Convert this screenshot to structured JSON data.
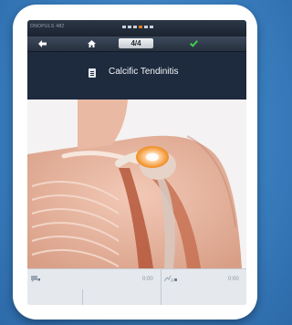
{
  "status_bar": {
    "app_name": "ONOPULS 482"
  },
  "navigation": {
    "back_icon": "back-arrow-icon",
    "home_icon": "home-icon",
    "page_indicator": "4/4",
    "done_icon": "checkmark-icon",
    "accent_done_color": "#3bd14a",
    "progress_dots_active_index": 3,
    "progress_dots_count": 6
  },
  "header": {
    "doc_icon": "document-icon",
    "title": "Calcific Tendinitis"
  },
  "illustration": {
    "subject": "shoulder anatomy illustration",
    "highlight_color": "#f08a1f"
  },
  "player": {
    "left_track": {
      "icon": "annotation-icon",
      "time": "0:00"
    },
    "right_track": {
      "icon": "audio-icon",
      "time": "0:00"
    }
  }
}
